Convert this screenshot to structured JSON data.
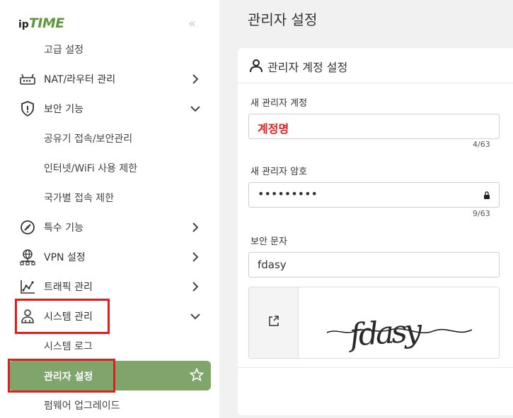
{
  "logo": {
    "ip": "ip",
    "time": "TIME"
  },
  "sidebar": {
    "collapse": "«",
    "items": [
      {
        "label": "고급 설정"
      },
      {
        "label": "NAT/라우터 관리"
      },
      {
        "label": "보안 기능"
      },
      {
        "label": "공유기 접속/보안관리"
      },
      {
        "label": "인터넷/WiFi 사용 제한"
      },
      {
        "label": "국가별 접속 제한"
      },
      {
        "label": "특수 기능"
      },
      {
        "label": "VPN 설정"
      },
      {
        "label": "트래픽 관리"
      },
      {
        "label": "시스템 관리"
      },
      {
        "label": "시스템 로그"
      },
      {
        "label": "관리자 설정"
      },
      {
        "label": "펌웨어 업그레이드"
      }
    ]
  },
  "main": {
    "page_title": "관리자 설정",
    "card_title": "관리자 계정 설정",
    "account": {
      "label": "새 관리자 계정",
      "value": "계정명",
      "counter": "4/63"
    },
    "password": {
      "label": "새 관리자 암호",
      "value": "•••••••••",
      "counter": "9/63"
    },
    "captcha": {
      "label": "보안 문자",
      "value": "fdasy",
      "image_text": "fdasy"
    }
  },
  "colors": {
    "accent": "#7fa56b",
    "highlight": "#e02020",
    "brand": "#5b9a3a"
  }
}
